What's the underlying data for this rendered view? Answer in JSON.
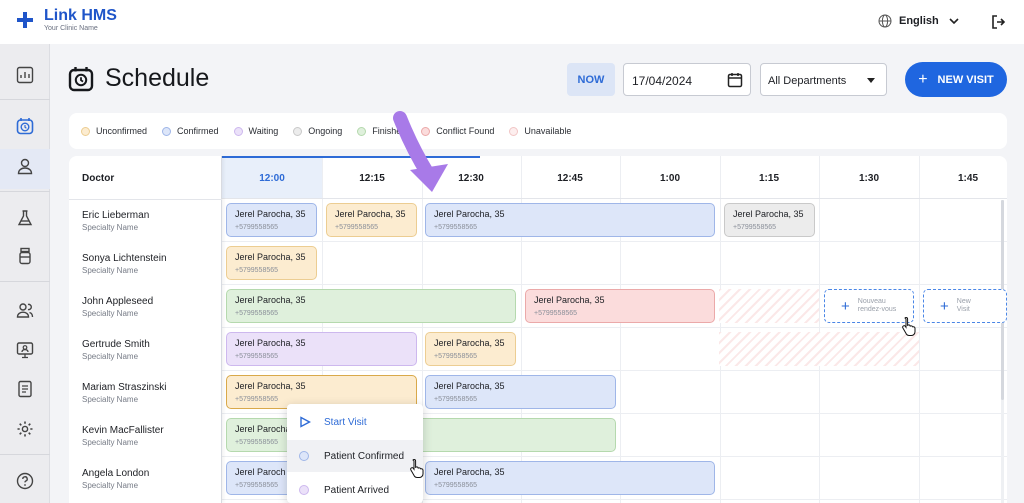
{
  "app": {
    "brand": "Link HMS",
    "clinic": "Your Clinic Name"
  },
  "topbar": {
    "language": "English"
  },
  "page": {
    "title": "Schedule"
  },
  "toolbar": {
    "now_label": "NOW",
    "date": "17/04/2024",
    "department": "All Departments",
    "new_visit": "NEW VISIT"
  },
  "legend": [
    {
      "label": "Unconfirmed",
      "fill": "#fcecd0",
      "stroke": "#eccd92"
    },
    {
      "label": "Confirmed",
      "fill": "#dde6f9",
      "stroke": "#9fb6e8"
    },
    {
      "label": "Waiting",
      "fill": "#ebe1f9",
      "stroke": "#cdb8ee"
    },
    {
      "label": "Ongoing",
      "fill": "#ececec",
      "stroke": "#c9c9c9"
    },
    {
      "label": "Finished",
      "fill": "#dff0dc",
      "stroke": "#b5d9ae"
    },
    {
      "label": "Conflict Found",
      "fill": "#fbdcdc",
      "stroke": "#eba9a9"
    },
    {
      "label": "Unavailable",
      "fill": "#fdeeee",
      "stroke": "#f1c6c6"
    }
  ],
  "grid": {
    "doctor_header": "Doctor",
    "times": [
      "12:00",
      "12:15",
      "12:30",
      "12:45",
      "1:00",
      "1:15",
      "1:30",
      "1:45"
    ],
    "doctors": [
      {
        "name": "Eric Lieberman",
        "spec": "Specialty Name"
      },
      {
        "name": "Sonya Lichtenstein",
        "spec": "Specialty Name"
      },
      {
        "name": "John Appleseed",
        "spec": "Specialty Name"
      },
      {
        "name": "Gertrude Smith",
        "spec": "Specialty Name"
      },
      {
        "name": "Mariam Straszinski",
        "spec": "Specialty Name"
      },
      {
        "name": "Kevin MacFallister",
        "spec": "Specialty Name"
      },
      {
        "name": "Angela London",
        "spec": "Specialty Name"
      }
    ],
    "patient": {
      "name": "Jerel Parocha, 35",
      "name_short": "Jerel Paroch",
      "phone": "+5799558565"
    }
  },
  "slots": {
    "new_fr_1": "Nouveau",
    "new_fr_2": "rendez-vous",
    "new_en_1": "New",
    "new_en_2": "Visit"
  },
  "menu": {
    "start": "Start Visit",
    "confirmed": "Patient Confirmed",
    "arrived": "Patient Arrived"
  },
  "colors": {
    "accent": "#1f66e0",
    "arrow": "#a87ae8"
  }
}
